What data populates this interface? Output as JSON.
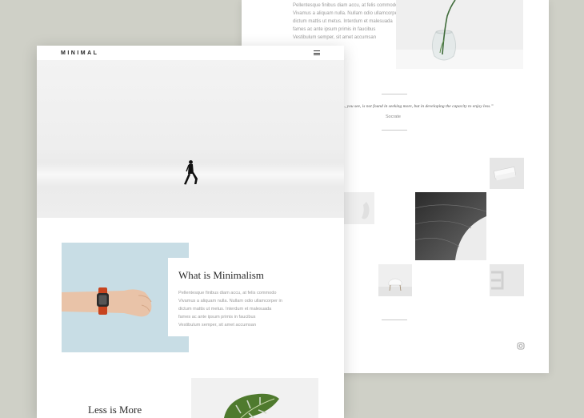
{
  "back_page": {
    "paragraph_lines": [
      "Pellentesque finibus diam accu, at felis commodo",
      "Vivamus a aliquam nulla. Nullam odio ullamcorper in",
      "dictum mattis ut metus. Interdum et malesuada",
      "fames ac ante ipsum primis in faucibus",
      "Vestibulum semper, sit amet accumsan"
    ],
    "quote": "…, you see, is not found in seeking more, but in developing the capacity to enjoy less.”",
    "quote_author": "Socrate"
  },
  "front_page": {
    "logo": "MINIMAL",
    "menu_icon": "hamburger-menu-icon",
    "card": {
      "title": "What is Minimalism",
      "body_lines": [
        "Pellentesque finibus diam accu, at felis commodo",
        "Vivamus a aliquam nulla. Nullam odio ullamcorper in",
        "dictum mattis ut metus. Interdum et malesuada",
        "fames ac ante ipsum primis in faucibus",
        "Vestibulum semper, sit amet accumsan"
      ]
    },
    "section_title": "Less is More"
  },
  "colors": {
    "background": "#cfd0c7",
    "card_photo_bg": "#c8dde5",
    "plant_green": "#4f7a2e"
  }
}
